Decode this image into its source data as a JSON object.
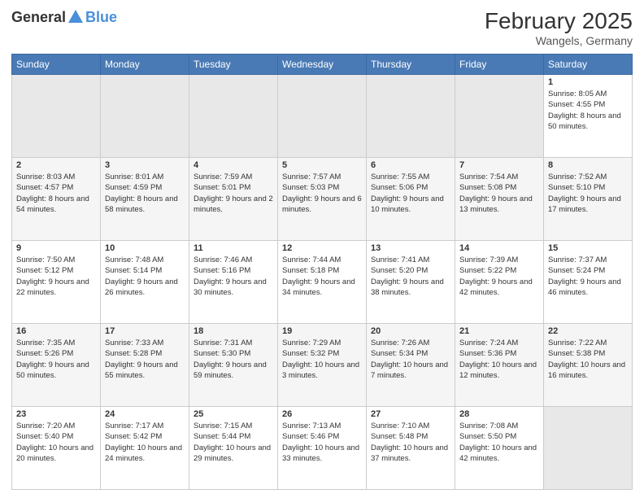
{
  "header": {
    "logo_general": "General",
    "logo_blue": "Blue",
    "title": "February 2025",
    "location": "Wangels, Germany"
  },
  "days_of_week": [
    "Sunday",
    "Monday",
    "Tuesday",
    "Wednesday",
    "Thursday",
    "Friday",
    "Saturday"
  ],
  "weeks": [
    [
      {
        "day": "",
        "empty": true
      },
      {
        "day": "",
        "empty": true
      },
      {
        "day": "",
        "empty": true
      },
      {
        "day": "",
        "empty": true
      },
      {
        "day": "",
        "empty": true
      },
      {
        "day": "",
        "empty": true
      },
      {
        "day": "1",
        "sunrise": "8:05 AM",
        "sunset": "4:55 PM",
        "daylight": "8 hours and 50 minutes."
      }
    ],
    [
      {
        "day": "2",
        "sunrise": "8:03 AM",
        "sunset": "4:57 PM",
        "daylight": "8 hours and 54 minutes."
      },
      {
        "day": "3",
        "sunrise": "8:01 AM",
        "sunset": "4:59 PM",
        "daylight": "8 hours and 58 minutes."
      },
      {
        "day": "4",
        "sunrise": "7:59 AM",
        "sunset": "5:01 PM",
        "daylight": "9 hours and 2 minutes."
      },
      {
        "day": "5",
        "sunrise": "7:57 AM",
        "sunset": "5:03 PM",
        "daylight": "9 hours and 6 minutes."
      },
      {
        "day": "6",
        "sunrise": "7:55 AM",
        "sunset": "5:06 PM",
        "daylight": "9 hours and 10 minutes."
      },
      {
        "day": "7",
        "sunrise": "7:54 AM",
        "sunset": "5:08 PM",
        "daylight": "9 hours and 13 minutes."
      },
      {
        "day": "8",
        "sunrise": "7:52 AM",
        "sunset": "5:10 PM",
        "daylight": "9 hours and 17 minutes."
      }
    ],
    [
      {
        "day": "9",
        "sunrise": "7:50 AM",
        "sunset": "5:12 PM",
        "daylight": "9 hours and 22 minutes."
      },
      {
        "day": "10",
        "sunrise": "7:48 AM",
        "sunset": "5:14 PM",
        "daylight": "9 hours and 26 minutes."
      },
      {
        "day": "11",
        "sunrise": "7:46 AM",
        "sunset": "5:16 PM",
        "daylight": "9 hours and 30 minutes."
      },
      {
        "day": "12",
        "sunrise": "7:44 AM",
        "sunset": "5:18 PM",
        "daylight": "9 hours and 34 minutes."
      },
      {
        "day": "13",
        "sunrise": "7:41 AM",
        "sunset": "5:20 PM",
        "daylight": "9 hours and 38 minutes."
      },
      {
        "day": "14",
        "sunrise": "7:39 AM",
        "sunset": "5:22 PM",
        "daylight": "9 hours and 42 minutes."
      },
      {
        "day": "15",
        "sunrise": "7:37 AM",
        "sunset": "5:24 PM",
        "daylight": "9 hours and 46 minutes."
      }
    ],
    [
      {
        "day": "16",
        "sunrise": "7:35 AM",
        "sunset": "5:26 PM",
        "daylight": "9 hours and 50 minutes."
      },
      {
        "day": "17",
        "sunrise": "7:33 AM",
        "sunset": "5:28 PM",
        "daylight": "9 hours and 55 minutes."
      },
      {
        "day": "18",
        "sunrise": "7:31 AM",
        "sunset": "5:30 PM",
        "daylight": "9 hours and 59 minutes."
      },
      {
        "day": "19",
        "sunrise": "7:29 AM",
        "sunset": "5:32 PM",
        "daylight": "10 hours and 3 minutes."
      },
      {
        "day": "20",
        "sunrise": "7:26 AM",
        "sunset": "5:34 PM",
        "daylight": "10 hours and 7 minutes."
      },
      {
        "day": "21",
        "sunrise": "7:24 AM",
        "sunset": "5:36 PM",
        "daylight": "10 hours and 12 minutes."
      },
      {
        "day": "22",
        "sunrise": "7:22 AM",
        "sunset": "5:38 PM",
        "daylight": "10 hours and 16 minutes."
      }
    ],
    [
      {
        "day": "23",
        "sunrise": "7:20 AM",
        "sunset": "5:40 PM",
        "daylight": "10 hours and 20 minutes."
      },
      {
        "day": "24",
        "sunrise": "7:17 AM",
        "sunset": "5:42 PM",
        "daylight": "10 hours and 24 minutes."
      },
      {
        "day": "25",
        "sunrise": "7:15 AM",
        "sunset": "5:44 PM",
        "daylight": "10 hours and 29 minutes."
      },
      {
        "day": "26",
        "sunrise": "7:13 AM",
        "sunset": "5:46 PM",
        "daylight": "10 hours and 33 minutes."
      },
      {
        "day": "27",
        "sunrise": "7:10 AM",
        "sunset": "5:48 PM",
        "daylight": "10 hours and 37 minutes."
      },
      {
        "day": "28",
        "sunrise": "7:08 AM",
        "sunset": "5:50 PM",
        "daylight": "10 hours and 42 minutes."
      },
      {
        "day": "",
        "empty": true
      }
    ]
  ]
}
